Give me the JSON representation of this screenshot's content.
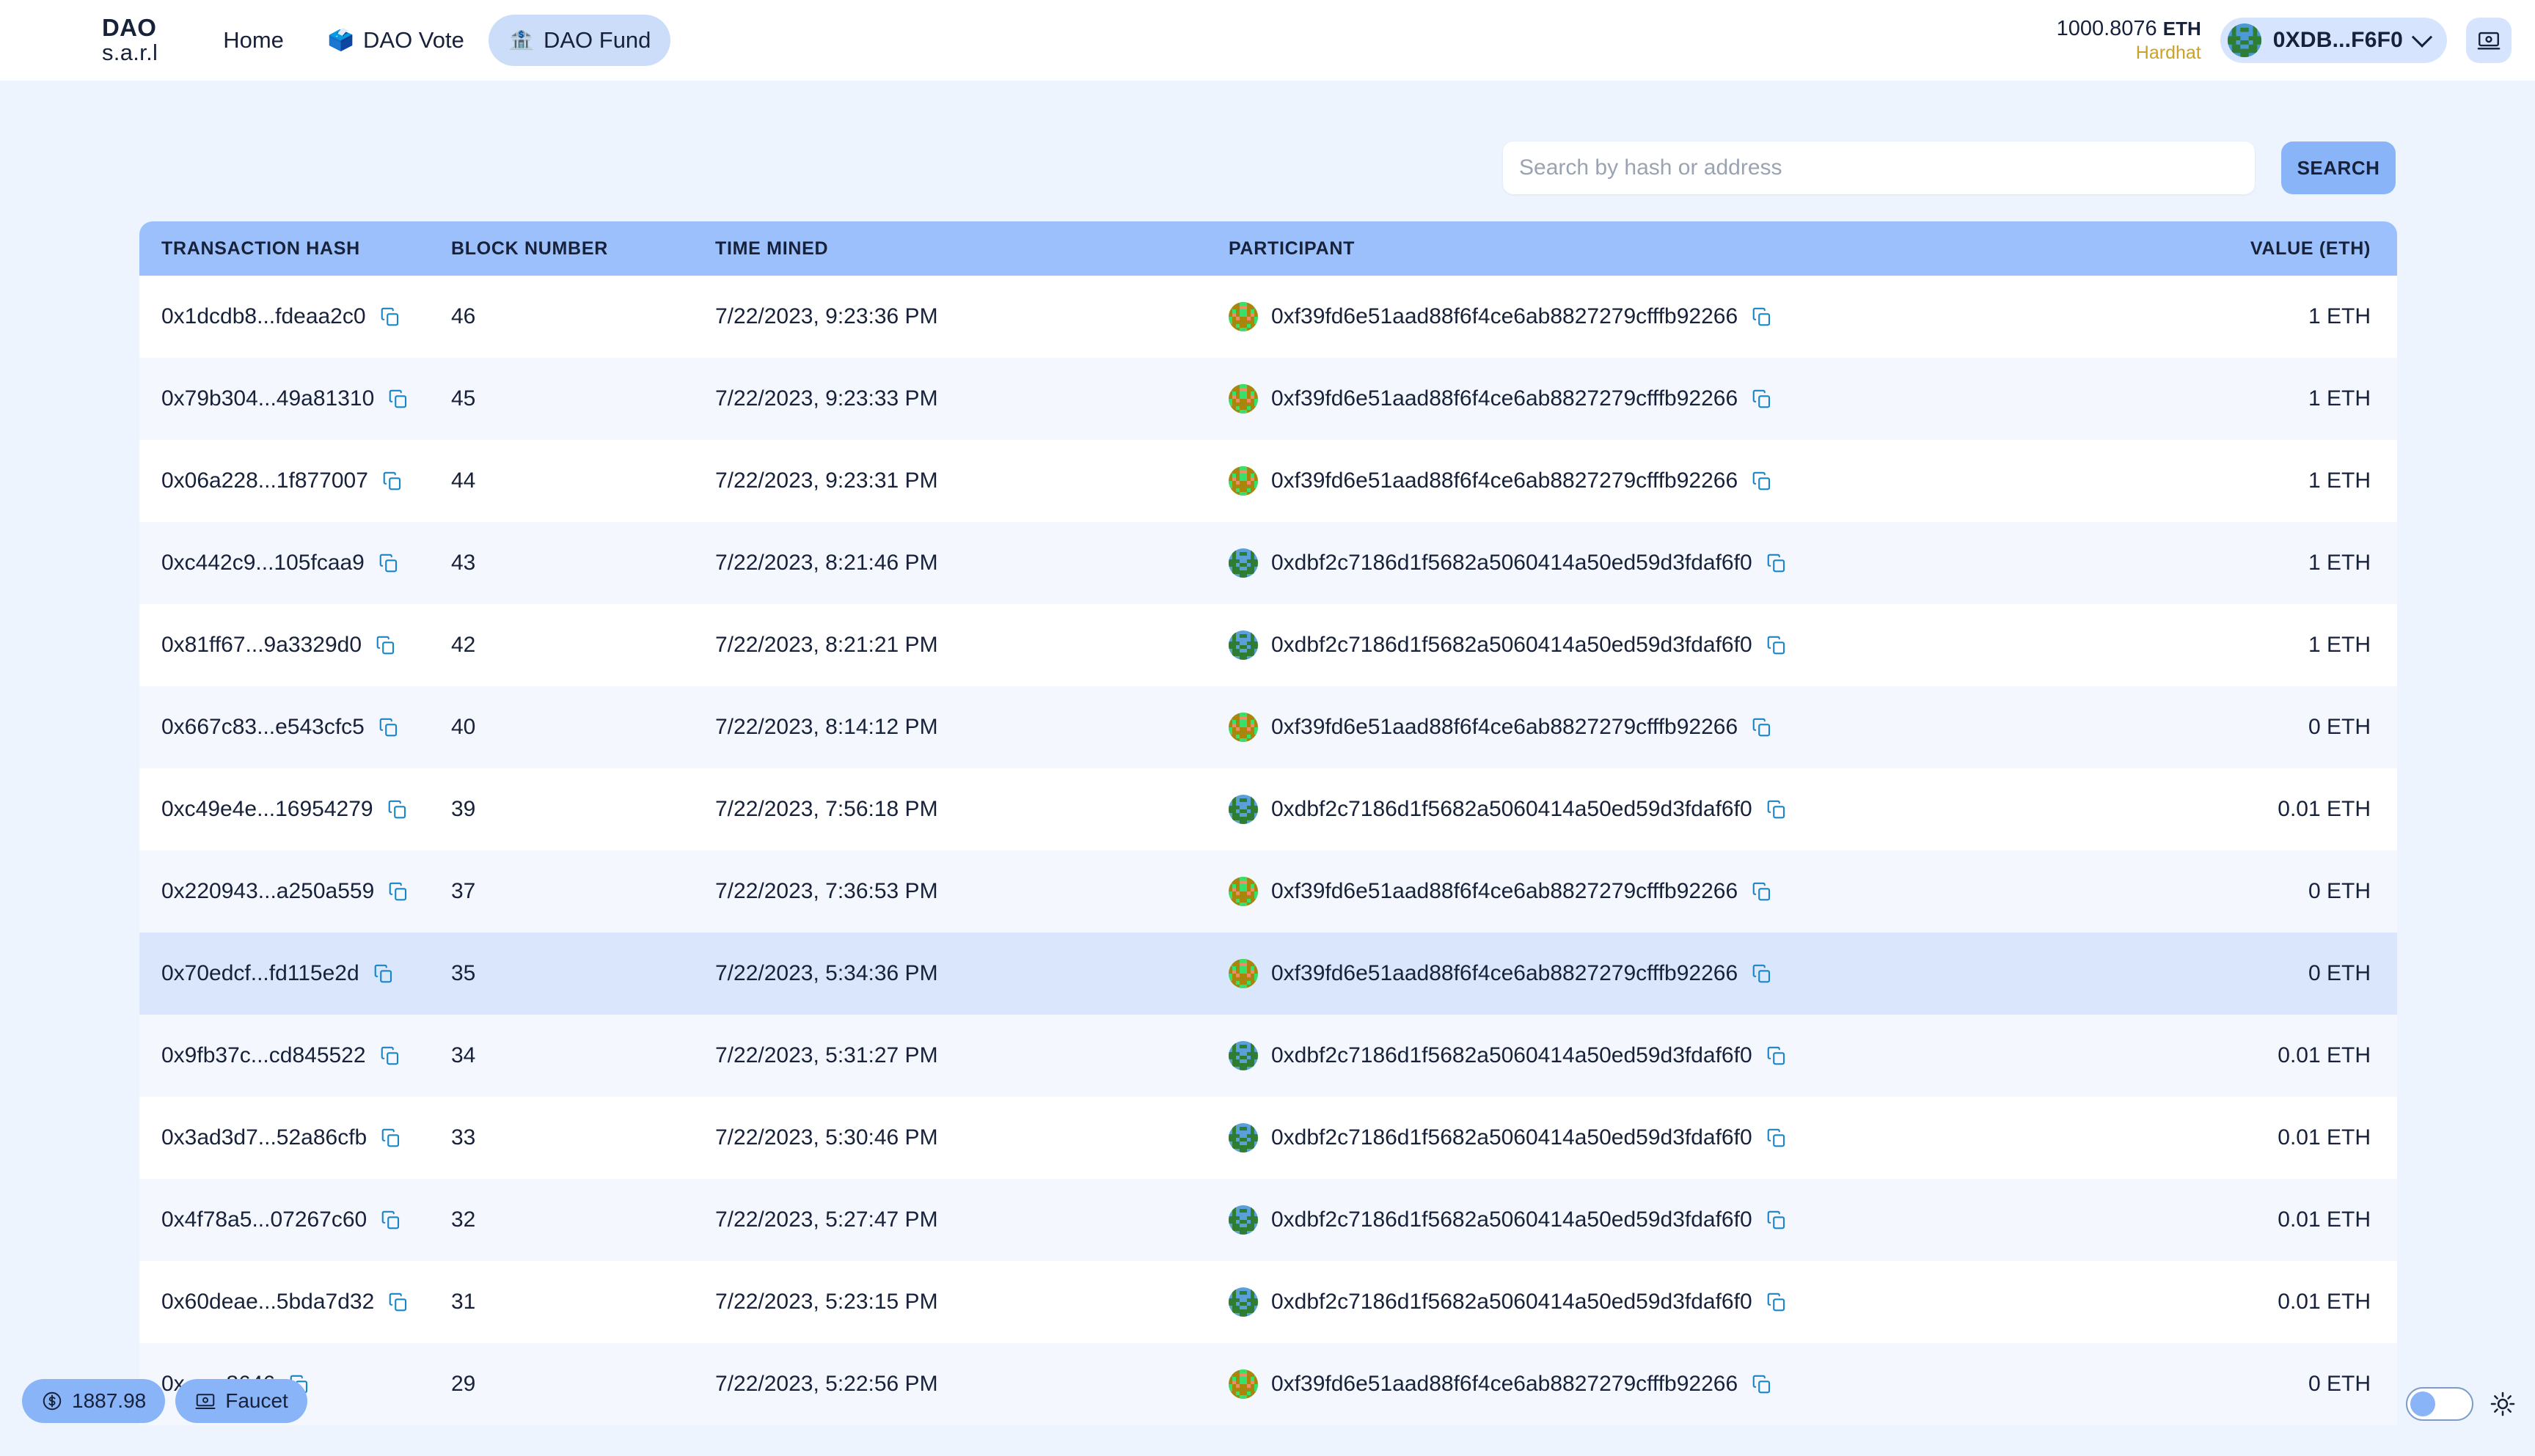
{
  "navbar": {
    "brand_top": "DAO",
    "brand_bottom": "s.a.r.l",
    "links": [
      {
        "label": "Home",
        "emoji": "",
        "active": false,
        "name": "nav-link-home"
      },
      {
        "label": "DAO Vote",
        "emoji": "🗳️",
        "active": false,
        "name": "nav-link-dao-vote"
      },
      {
        "label": "DAO Fund",
        "emoji": "🏦",
        "active": true,
        "name": "nav-link-dao-fund"
      }
    ],
    "balance_amount": "1000.8076",
    "balance_unit": "ETH",
    "network": "Hardhat",
    "account": "0XDB...F6F0",
    "chevron_icon": "chevron-down-icon",
    "wallet_icon": "wallet-icon"
  },
  "search": {
    "placeholder": "Search by hash or address",
    "value": "",
    "button_label": "SEARCH"
  },
  "table": {
    "columns": [
      "TRANSACTION HASH",
      "BLOCK NUMBER",
      "TIME MINED",
      "PARTICIPANT",
      "VALUE (ETH)"
    ],
    "rows": [
      {
        "hash": "0x1dcdb8...fdeaa2c0",
        "block": "46",
        "time": "7/22/2023, 9:23:36 PM",
        "participant": "0xf39fd6e51aad88f6f4ce6ab8827279cfffb92266",
        "avatar": "gold",
        "value": "1 ETH",
        "row_style": "plain"
      },
      {
        "hash": "0x79b304...49a81310",
        "block": "45",
        "time": "7/22/2023, 9:23:33 PM",
        "participant": "0xf39fd6e51aad88f6f4ce6ab8827279cfffb92266",
        "avatar": "gold",
        "value": "1 ETH",
        "row_style": "alt"
      },
      {
        "hash": "0x06a228...1f877007",
        "block": "44",
        "time": "7/22/2023, 9:23:31 PM",
        "participant": "0xf39fd6e51aad88f6f4ce6ab8827279cfffb92266",
        "avatar": "gold",
        "value": "1 ETH",
        "row_style": "plain"
      },
      {
        "hash": "0xc442c9...105fcaa9",
        "block": "43",
        "time": "7/22/2023, 8:21:46 PM",
        "participant": "0xdbf2c7186d1f5682a5060414a50ed59d3fdaf6f0",
        "avatar": "green",
        "value": "1 ETH",
        "row_style": "alt"
      },
      {
        "hash": "0x81ff67...9a3329d0",
        "block": "42",
        "time": "7/22/2023, 8:21:21 PM",
        "participant": "0xdbf2c7186d1f5682a5060414a50ed59d3fdaf6f0",
        "avatar": "green",
        "value": "1 ETH",
        "row_style": "plain"
      },
      {
        "hash": "0x667c83...e543cfc5",
        "block": "40",
        "time": "7/22/2023, 8:14:12 PM",
        "participant": "0xf39fd6e51aad88f6f4ce6ab8827279cfffb92266",
        "avatar": "gold",
        "value": "0 ETH",
        "row_style": "alt"
      },
      {
        "hash": "0xc49e4e...16954279",
        "block": "39",
        "time": "7/22/2023, 7:56:18 PM",
        "participant": "0xdbf2c7186d1f5682a5060414a50ed59d3fdaf6f0",
        "avatar": "green",
        "value": "0.01 ETH",
        "row_style": "plain"
      },
      {
        "hash": "0x220943...a250a559",
        "block": "37",
        "time": "7/22/2023, 7:36:53 PM",
        "participant": "0xf39fd6e51aad88f6f4ce6ab8827279cfffb92266",
        "avatar": "gold",
        "value": "0 ETH",
        "row_style": "alt"
      },
      {
        "hash": "0x70edcf...fd115e2d",
        "block": "35",
        "time": "7/22/2023, 5:34:36 PM",
        "participant": "0xf39fd6e51aad88f6f4ce6ab8827279cfffb92266",
        "avatar": "gold",
        "value": "0 ETH",
        "row_style": "highlight"
      },
      {
        "hash": "0x9fb37c...cd845522",
        "block": "34",
        "time": "7/22/2023, 5:31:27 PM",
        "participant": "0xdbf2c7186d1f5682a5060414a50ed59d3fdaf6f0",
        "avatar": "green",
        "value": "0.01 ETH",
        "row_style": "alt"
      },
      {
        "hash": "0x3ad3d7...52a86cfb",
        "block": "33",
        "time": "7/22/2023, 5:30:46 PM",
        "participant": "0xdbf2c7186d1f5682a5060414a50ed59d3fdaf6f0",
        "avatar": "green",
        "value": "0.01 ETH",
        "row_style": "plain"
      },
      {
        "hash": "0x4f78a5...07267c60",
        "block": "32",
        "time": "7/22/2023, 5:27:47 PM",
        "participant": "0xdbf2c7186d1f5682a5060414a50ed59d3fdaf6f0",
        "avatar": "green",
        "value": "0.01 ETH",
        "row_style": "alt"
      },
      {
        "hash": "0x60deae...5bda7d32",
        "block": "31",
        "time": "7/22/2023, 5:23:15 PM",
        "participant": "0xdbf2c7186d1f5682a5060414a50ed59d3fdaf6f0",
        "avatar": "green",
        "value": "0.01 ETH",
        "row_style": "plain"
      },
      {
        "hash": "0x...ec8646",
        "block": "29",
        "time": "7/22/2023, 5:22:56 PM",
        "participant": "0xf39fd6e51aad88f6f4ce6ab8827279cfffb92266",
        "avatar": "gold",
        "value": "0 ETH",
        "row_style": "alt"
      }
    ],
    "copy_icon": "copy-icon"
  },
  "floating": {
    "price_label": "1887.98",
    "price_icon": "dollar-circle-icon",
    "faucet_label": "Faucet",
    "faucet_icon": "faucet-screen-icon"
  },
  "theme": {
    "toggle_state": "off",
    "sun_icon": "sun-icon"
  },
  "colors": {
    "page_bg": "#eef4fd",
    "accent": "#8ab4f8",
    "header_row": "#9cc0fb",
    "active_pill": "#ccddfa",
    "network_text": "#c9a227",
    "copy_icon": "#1785c8",
    "highlight_row": "#d9e6fb"
  }
}
